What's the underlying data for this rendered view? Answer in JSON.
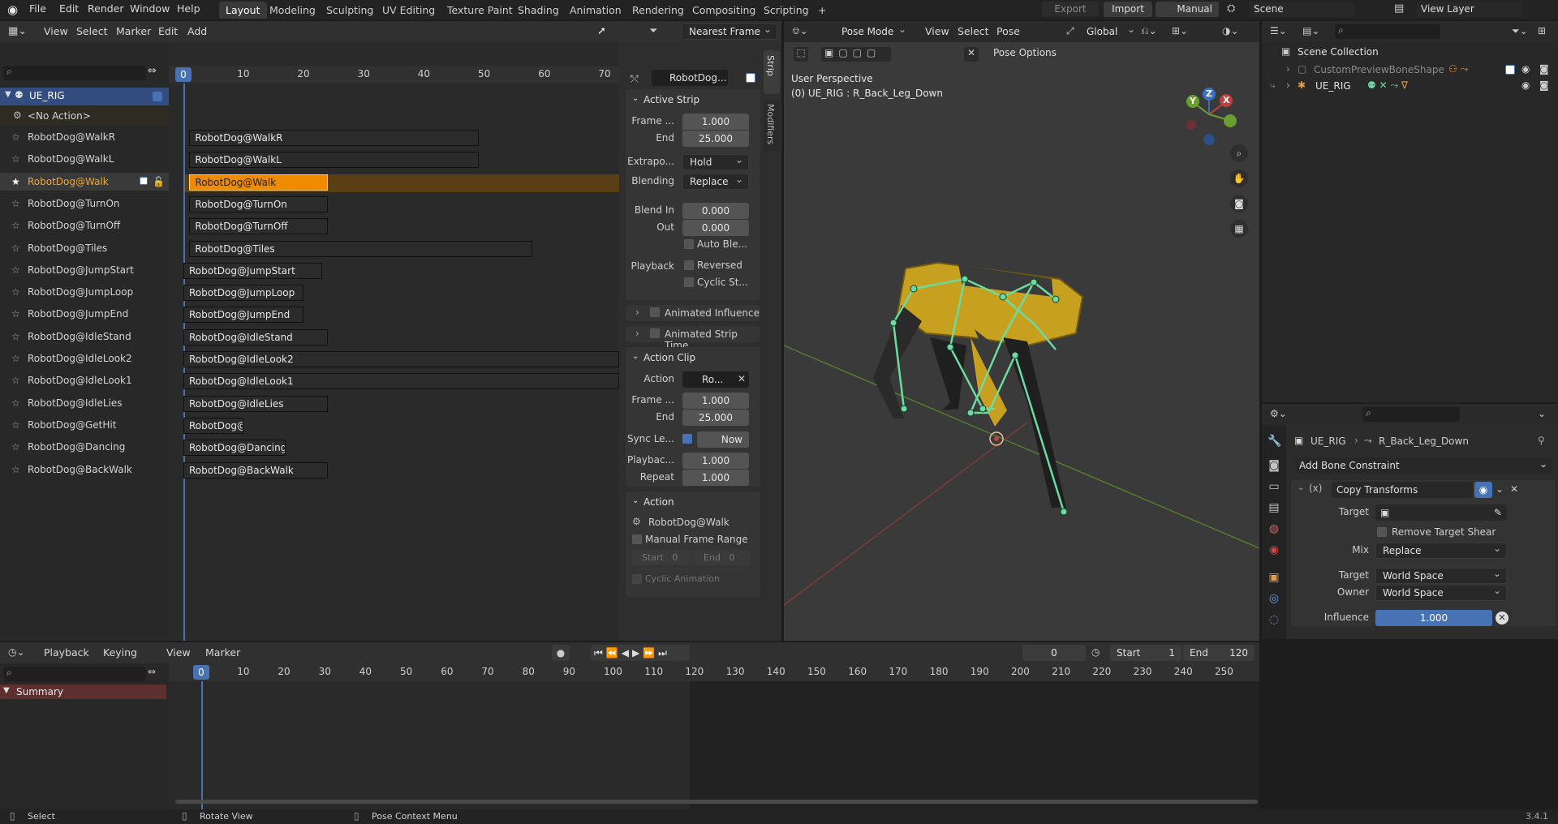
{
  "menubar": {
    "items": [
      "File",
      "Edit",
      "Render",
      "Window",
      "Help"
    ],
    "workspaces": [
      "Layout",
      "Modeling",
      "Sculpting",
      "UV Editing",
      "Texture Paint",
      "Shading",
      "Animation",
      "Rendering",
      "Compositing",
      "Scripting"
    ],
    "active_workspace": "Layout",
    "add_tab": "+",
    "export_label": "Export",
    "import_label": "Import",
    "manual_label": "Manual",
    "scene": "Scene",
    "view_layer": "View Layer"
  },
  "nla": {
    "menus": [
      "View",
      "Select",
      "Marker",
      "Edit",
      "Add"
    ],
    "snap": "Nearest Frame",
    "current_frame": "0",
    "ruler": [
      "10",
      "20",
      "30",
      "40",
      "50",
      "60",
      "70"
    ],
    "object": "UE_RIG",
    "no_action": "<No Action>",
    "tracks": [
      "RobotDog@WalkR",
      "RobotDog@WalkL",
      "RobotDog@Walk",
      "RobotDog@TurnOn",
      "RobotDog@TurnOff",
      "RobotDog@Tiles",
      "RobotDog@JumpStart",
      "RobotDog@JumpLoop",
      "RobotDog@JumpEnd",
      "RobotDog@IdleStand",
      "RobotDog@IdleLook2",
      "RobotDog@IdleLook1",
      "RobotDog@IdleLies",
      "RobotDog@GetHit",
      "RobotDog@Dancing",
      "RobotDog@BackWalk"
    ],
    "strips": [
      "RobotDog@WalkR",
      "RobotDog@WalkL",
      "RobotDog@Walk",
      "RobotDog@TurnOn",
      "RobotDog@TurnOff",
      "RobotDog@Tiles",
      "RobotDog@JumpStart",
      "RobotDog@JumpLoop",
      "RobotDog@JumpEnd",
      "RobotDog@IdleStand",
      "RobotDog@IdleLook2",
      "RobotDog@IdleLook1",
      "RobotDog@IdleLies",
      "RobotDog@",
      "RobotDog@Dancing",
      "RobotDog@BackWalk"
    ],
    "active_track": "RobotDog@Walk"
  },
  "sidebar": {
    "header_strip_name": "RobotDog...",
    "tabs": [
      "Strip",
      "Modifiers"
    ],
    "active_strip": {
      "title": "Active Strip",
      "frame_start_label": "Frame ...",
      "frame_start": "1.000",
      "end_label": "End",
      "end": "25.000",
      "extrapolation_label": "Extrapo...",
      "extrapolation": "Hold",
      "blending_label": "Blending",
      "blending": "Replace",
      "blend_in_label": "Blend In",
      "blend_in": "0.000",
      "out_label": "Out",
      "out": "0.000",
      "auto_blend": "Auto Ble...",
      "playback_label": "Playback",
      "reversed": "Reversed",
      "cyclic": "Cyclic St...",
      "animated_influence": "Animated Influence",
      "animated_strip_time": "Animated Strip Time"
    },
    "action_clip": {
      "title": "Action Clip",
      "action_label": "Action",
      "action_value": "Ro...",
      "frame_label": "Frame ...",
      "frame": "1.000",
      "end_label": "End",
      "end": "25.000",
      "sync_label": "Sync Le...",
      "now": "Now",
      "playback_label": "Playbac...",
      "playback": "1.000",
      "repeat_label": "Repeat",
      "repeat": "1.000"
    },
    "action": {
      "title": "Action",
      "name": "RobotDog@Walk",
      "manual_range": "Manual Frame Range",
      "start_label": "Start",
      "start": "0",
      "end_label": "End",
      "end": "0",
      "cyclic": "Cyclic Animation"
    }
  },
  "viewport": {
    "mode": "Pose Mode",
    "menus": [
      "View",
      "Select",
      "Pose"
    ],
    "orientation": "Global",
    "pose_options": "Pose Options",
    "perspective": "User Perspective",
    "active": "(0) UE_RIG : R_Back_Leg_Down",
    "gizmo": {
      "x": "X",
      "y": "Y",
      "z": "Z"
    }
  },
  "outliner": {
    "root": "Scene Collection",
    "items": [
      "CustomPreviewBoneShape",
      "UE_RIG"
    ]
  },
  "properties": {
    "breadcrumb_obj": "UE_RIG",
    "breadcrumb_bone": "R_Back_Leg_Down",
    "add_constraint": "Add Bone Constraint",
    "constraint_name": "Copy Transforms",
    "target_label": "Target",
    "remove_shear": "Remove Target Shear",
    "mix_label": "Mix",
    "mix": "Replace",
    "target_space_label": "Target",
    "target_space": "World Space",
    "owner_label": "Owner",
    "owner_space": "World Space",
    "influence_label": "Influence",
    "influence": "1.000",
    "influence_fraction": 1.0
  },
  "timeline": {
    "menus": [
      "Playback",
      "Keying",
      "View",
      "Marker"
    ],
    "current": "0",
    "start_label": "Start",
    "start": "1",
    "end_label": "End",
    "end": "120",
    "ruler": [
      "10",
      "20",
      "30",
      "40",
      "50",
      "60",
      "70",
      "80",
      "90",
      "100",
      "110",
      "120",
      "130",
      "140",
      "150",
      "160",
      "170",
      "180",
      "190",
      "200",
      "210",
      "220",
      "230",
      "240",
      "250"
    ],
    "summary": "Summary"
  },
  "statusbar": {
    "select": "Select",
    "rotate": "Rotate View",
    "context": "Pose Context Menu",
    "version": "3.4.1"
  },
  "colors": {
    "accent": "#4772b3",
    "active_strip": "#f08a00",
    "active_track_text": "#f5a623",
    "bone": "#6bdba0"
  }
}
